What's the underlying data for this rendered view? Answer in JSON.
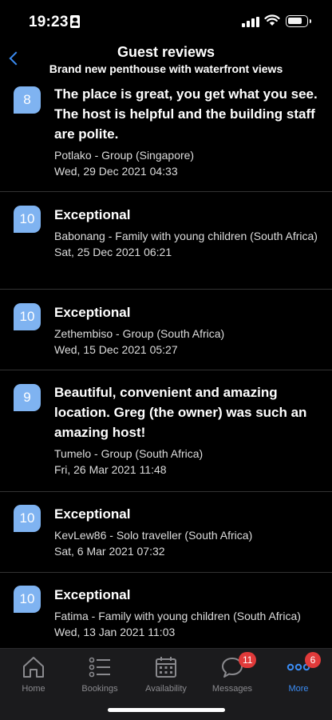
{
  "status_bar": {
    "time": "19:23"
  },
  "header": {
    "title": "Guest reviews",
    "subtitle": "Brand new penthouse with waterfront views"
  },
  "reviews": [
    {
      "score": "8",
      "title": "The place is great, you get what you see. The host is helpful and the building staff are polite.",
      "author": "Potlako - Group (Singapore)",
      "date": "Wed, 29 Dec 2021 04:33"
    },
    {
      "score": "10",
      "title": "Exceptional",
      "author": "Babonang - Family with young children (South Africa)",
      "date": "Sat, 25 Dec 2021 06:21"
    },
    {
      "score": "10",
      "title": "Exceptional",
      "author": "Zethembiso - Group (South Africa)",
      "date": "Wed, 15 Dec 2021 05:27"
    },
    {
      "score": "9",
      "title": "Beautiful, convenient and amazing location. Greg (the owner) was such an amazing  host!",
      "author": "Tumelo - Group (South Africa)",
      "date": "Fri, 26 Mar 2021 11:48"
    },
    {
      "score": "10",
      "title": "Exceptional",
      "author": "KevLew86 - Solo traveller (South Africa)",
      "date": "Sat, 6 Mar 2021 07:32"
    },
    {
      "score": "10",
      "title": "Exceptional",
      "author": "Fatima - Family with young children (South Africa)",
      "date": "Wed, 13 Jan 2021 11:03"
    }
  ],
  "tab_bar": {
    "tabs": [
      {
        "label": "Home",
        "icon": "home-icon"
      },
      {
        "label": "Bookings",
        "icon": "list-icon"
      },
      {
        "label": "Availability",
        "icon": "calendar-icon"
      },
      {
        "label": "Messages",
        "icon": "chat-bubble-icon",
        "badge": "11"
      },
      {
        "label": "More",
        "icon": "more-dots-icon",
        "badge": "6",
        "active": true
      }
    ]
  },
  "colors": {
    "accent": "#3b8cf3",
    "score_badge": "#7fb3f1",
    "notification": "#e03a3a",
    "background": "#000000"
  }
}
